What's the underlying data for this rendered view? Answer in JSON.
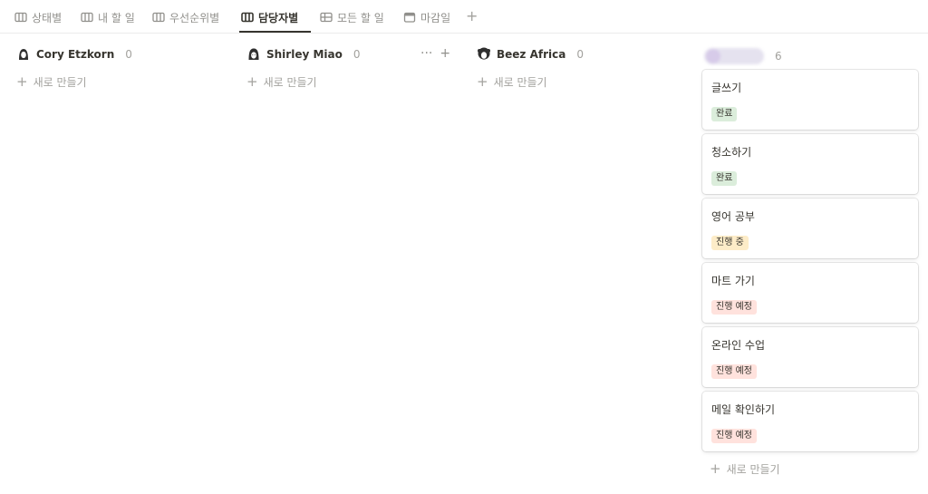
{
  "tabs": [
    {
      "label": "상태별"
    },
    {
      "label": "내 할 일"
    },
    {
      "label": "우선순위별"
    },
    {
      "label": "담당자별"
    },
    {
      "label": "모든 할 일"
    },
    {
      "label": "마감일"
    }
  ],
  "tab_add": "+",
  "columns": [
    {
      "name": "Cory Etzkorn",
      "count": "0",
      "new_label": "새로 만들기"
    },
    {
      "name": "Shirley Miao",
      "count": "0",
      "new_label": "새로 만들기",
      "tools": {
        "more": "···",
        "add": "+"
      }
    },
    {
      "name": "Beez Africa",
      "count": "0",
      "new_label": "새로 만들기"
    },
    {
      "count": "6",
      "new_label": "새로 만들기"
    }
  ],
  "plus_glyph": "+",
  "cards": [
    {
      "title": "글쓰기",
      "status": "완료"
    },
    {
      "title": "청소하기",
      "status": "완료"
    },
    {
      "title": "영어 공부",
      "status": "진행 중"
    },
    {
      "title": "마트 가기",
      "status": "진행 예정"
    },
    {
      "title": "온라인 수업",
      "status": "진행 예정"
    },
    {
      "title": "메일 확인하기",
      "status": "진행 예정"
    }
  ],
  "colors": {
    "done_tag": "#dbeddb",
    "in_progress_tag": "#fdecc8",
    "planned_tag": "#ffe2dd",
    "text": "#37352f",
    "muted": "#a3a29e"
  }
}
